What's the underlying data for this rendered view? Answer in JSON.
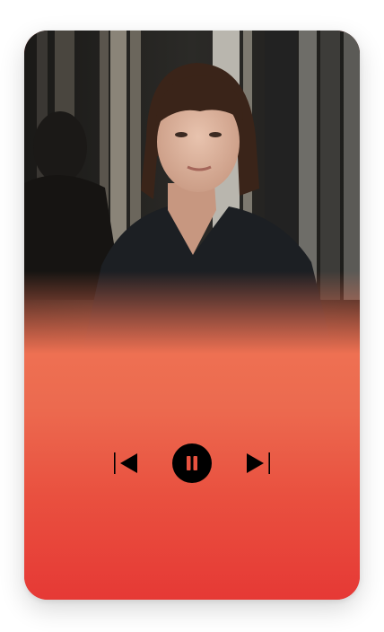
{
  "player": {
    "cover_photo": "portrait-photo",
    "controls": {
      "previous_icon": "skip-previous-icon",
      "pause_icon": "pause-icon",
      "next_icon": "skip-next-icon"
    },
    "colors": {
      "accent_top": "#ee7052",
      "accent_bottom": "#e63935",
      "controls": "#000000"
    }
  }
}
